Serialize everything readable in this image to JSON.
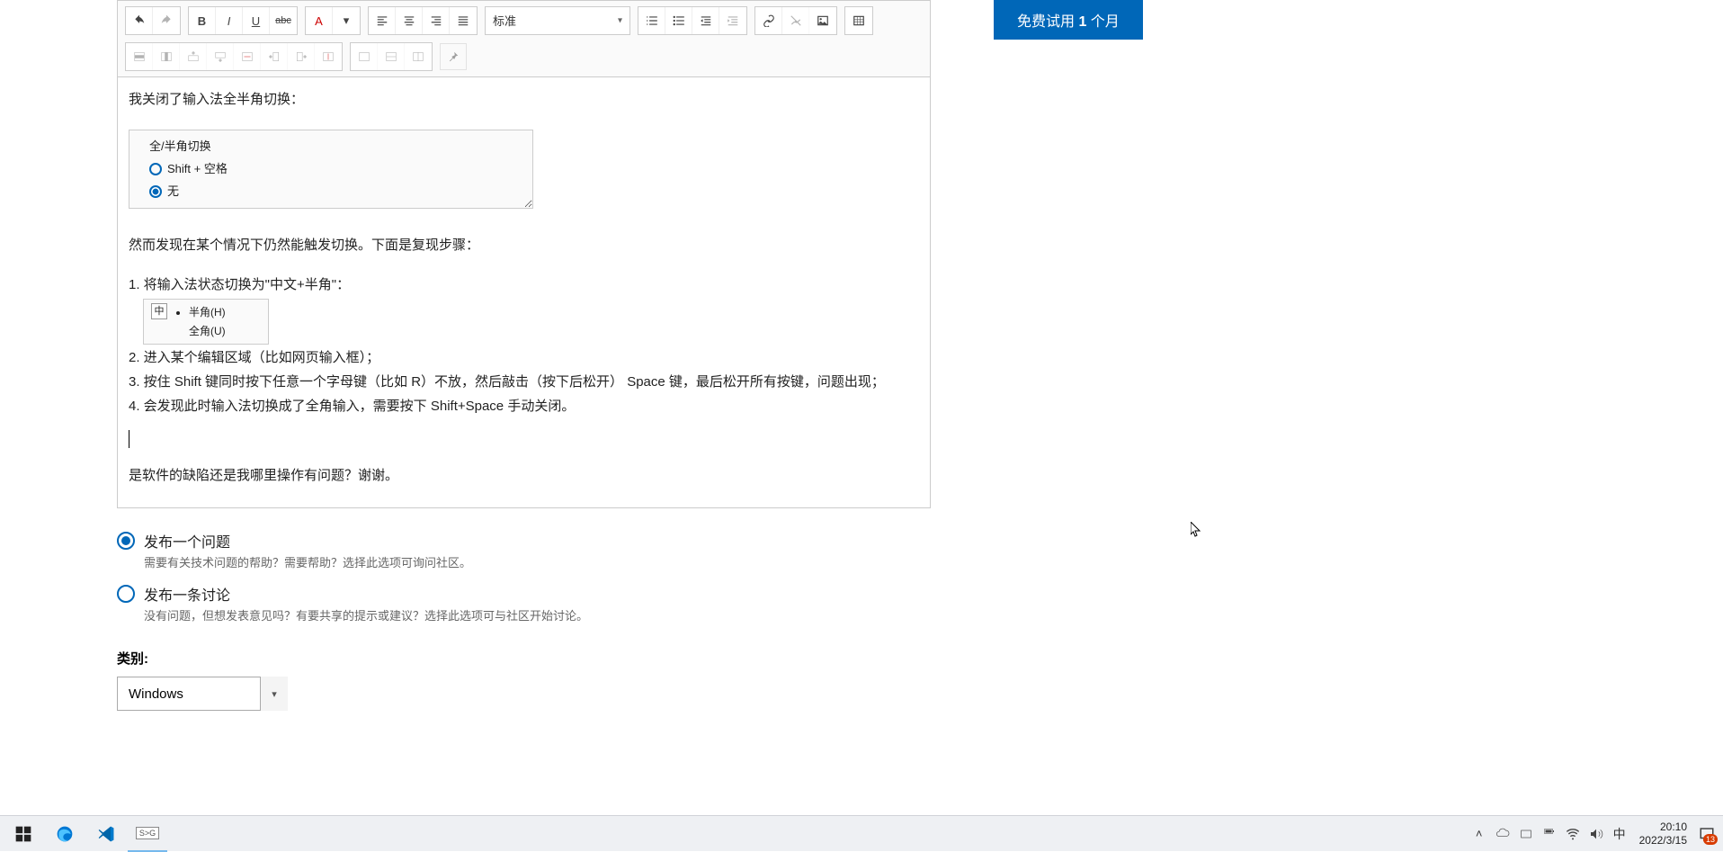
{
  "toolbar": {
    "format_select": "标准"
  },
  "editor": {
    "line1": "我关闭了输入法全半角切换：",
    "img1_title": "全/半角切换",
    "img1_opt1": "Shift + 空格",
    "img1_opt2": "无",
    "line2": "然而发现在某个情况下仍然能触发切换。下面是复现步骤：",
    "step1": "1. 将输入法状态切换为\"中文+半角\"：",
    "img2_icon": "中",
    "img2_item1": "半角(H)",
    "img2_item2": "全角(U)",
    "step2": "2. 进入某个编辑区域（比如网页输入框）；",
    "step3": "3. 按住 Shift 键同时按下任意一个字母键（比如 R）不放，然后敲击（按下后松开） Space 键，最后松开所有按键，问题出现；",
    "step4": "4. 会发现此时输入法切换成了全角输入，需要按下 Shift+Space 手动关闭。",
    "closing": "是软件的缺陷还是我哪里操作有问题？谢谢。"
  },
  "post_type": {
    "q_title": "发布一个问题",
    "q_desc": "需要有关技术问题的帮助？需要帮助？选择此选项可询问社区。",
    "d_title": "发布一条讨论",
    "d_desc": "没有问题，但想发表意见吗？有要共享的提示或建议？选择此选项可与社区开始讨论。"
  },
  "category": {
    "label": "类别:",
    "value": "Windows"
  },
  "promo": {
    "prefix": "免费试用 ",
    "bold": "1",
    "suffix": " 个月"
  },
  "taskbar": {
    "ime": "中",
    "time": "20:10",
    "date": "2022/3/15",
    "notif_count": "13"
  }
}
